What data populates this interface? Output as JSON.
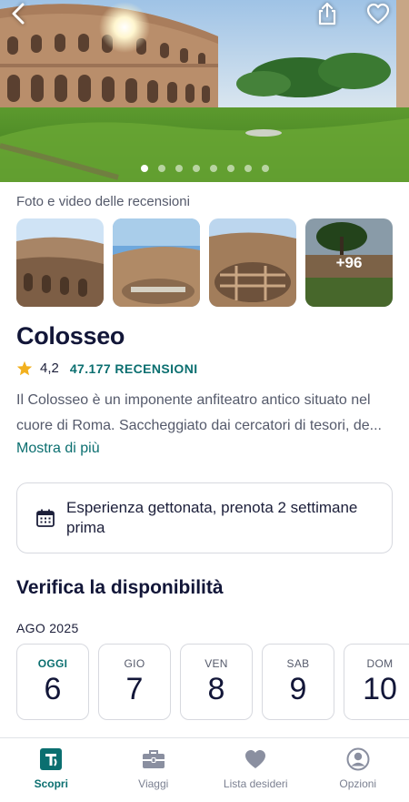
{
  "hero": {
    "image_alt": "Colosseo",
    "photo_count": 8,
    "active_index": 0
  },
  "gallery": {
    "label": "Foto e video delle recensioni",
    "more_count": "+96"
  },
  "attraction": {
    "name": "Colosseo",
    "rating": "4,2",
    "reviews": "47.177 RECENSIONI",
    "description_line1": "Il Colosseo è un imponente anfiteatro antico situato nel",
    "description_line2": "cuore di Roma. Saccheggiato dai cercatori di tesori, de...",
    "more_label": "Mostra di più"
  },
  "alert": {
    "text": "Esperienza gettonata, prenota 2 settimane prima"
  },
  "availability": {
    "title": "Verifica la disponibilità",
    "month": "AGO 2025",
    "days": [
      {
        "name": "OGGI",
        "num": "6"
      },
      {
        "name": "GIO",
        "num": "7"
      },
      {
        "name": "VEN",
        "num": "8"
      },
      {
        "name": "SAB",
        "num": "9"
      },
      {
        "name": "DOM",
        "num": "10"
      }
    ]
  },
  "tabs": [
    {
      "label": "Scopri",
      "icon": "tripadvisor-logo-icon"
    },
    {
      "label": "Viaggi",
      "icon": "briefcase-icon"
    },
    {
      "label": "Lista desideri",
      "icon": "heart-icon"
    },
    {
      "label": "Opzioni",
      "icon": "profile-icon"
    }
  ],
  "colors": {
    "accent": "#0b6f70",
    "title": "#121638",
    "star": "#f2b01e"
  }
}
